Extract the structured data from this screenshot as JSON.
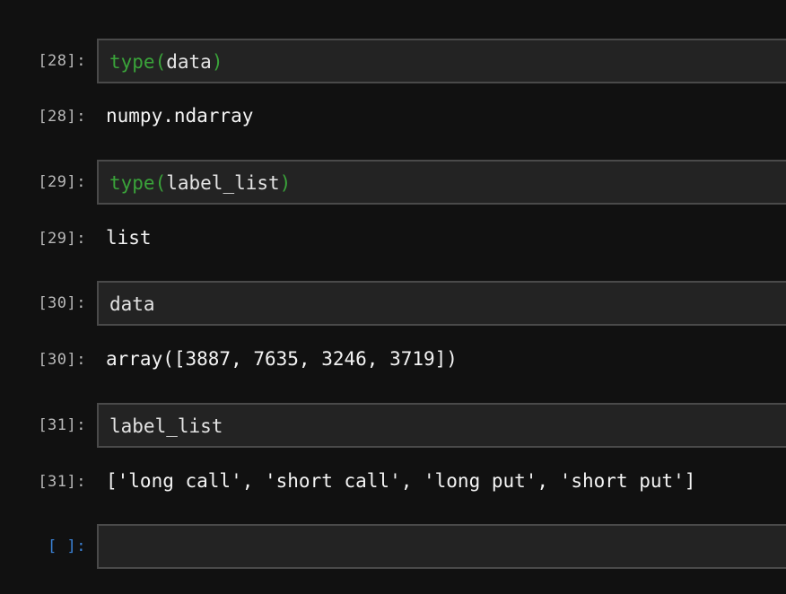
{
  "cells": [
    {
      "in_prompt": "[28]:",
      "code_fn": "type",
      "code_open": "(",
      "code_arg": "data",
      "code_close": ")",
      "out_prompt": "[28]:",
      "output": "numpy.ndarray"
    },
    {
      "in_prompt": "[29]:",
      "code_fn": "type",
      "code_open": "(",
      "code_arg": "label_list",
      "code_close": ")",
      "out_prompt": "[29]:",
      "output": "list"
    },
    {
      "in_prompt": "[30]:",
      "code": "data",
      "out_prompt": "[30]:",
      "output": "array([3887, 7635, 3246, 3719])"
    },
    {
      "in_prompt": "[31]:",
      "code": "label_list",
      "out_prompt": "[31]:",
      "output": "['long call', 'short call', 'long put', 'short put']"
    }
  ],
  "empty_cell": {
    "prompt": "[ ]:"
  },
  "colors": {
    "background": "#111111",
    "cell_background": "#232323",
    "cell_border": "#4a4a4a",
    "keyword_green": "#3aa33a",
    "prompt_gray": "#b9b9b9",
    "empty_prompt_blue": "#3b82d6"
  }
}
